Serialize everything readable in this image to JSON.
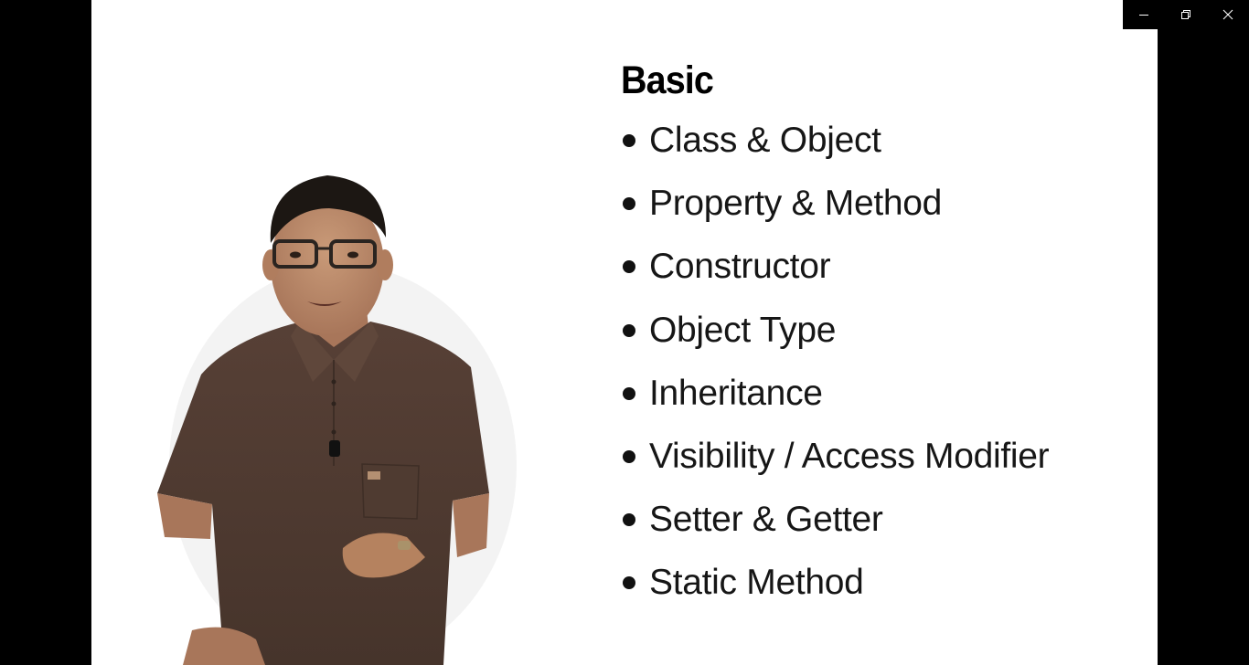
{
  "slide": {
    "title": "Basic",
    "topics": [
      "Class & Object",
      "Property & Method",
      "Constructor",
      "Object Type",
      "Inheritance",
      "Visibility / Access Modifier",
      "Setter & Getter",
      "Static Method"
    ]
  },
  "window_controls": {
    "minimize_icon": "minimize-icon",
    "restore_icon": "restore-icon",
    "close_icon": "close-icon"
  },
  "colors": {
    "background": "#000000",
    "slide": "#ffffff",
    "text": "#161616",
    "shirt": "#4e3a30"
  }
}
